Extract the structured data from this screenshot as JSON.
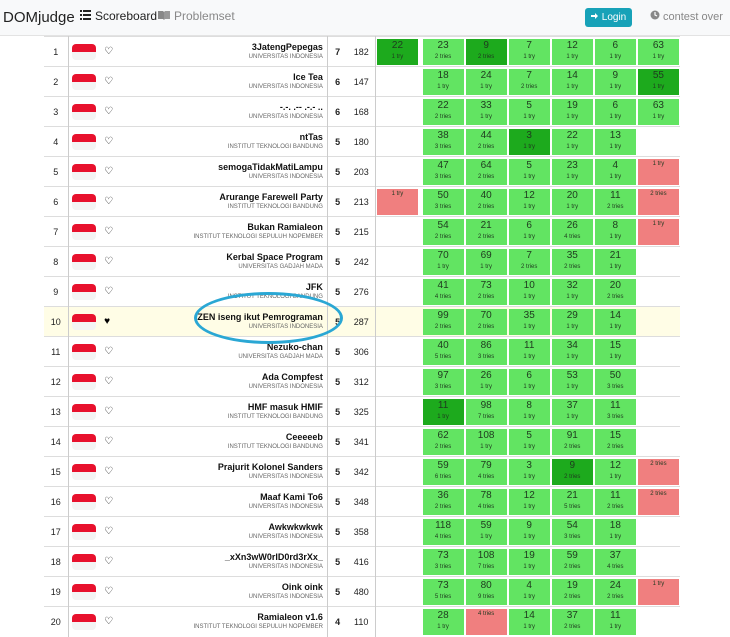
{
  "navbar": {
    "brand": "DOMjudge",
    "scoreboard_label": "Scoreboard",
    "problemset_label": "Problemset",
    "login_label": "Login",
    "status": "contest over"
  },
  "colors": {
    "solved": "#62e462",
    "first": "#1daa1d",
    "failed": "#f07f7f",
    "highlight": "#fffde6",
    "annotation": "#2aa7d4"
  },
  "rows": [
    {
      "rank": "1",
      "team": "3JatengPepegas",
      "affil": "UNIVERSITAS INDONESIA",
      "solved": "7",
      "penalty": "182",
      "fav": false,
      "highlight": false,
      "cells": [
        {
          "time": "22",
          "tries": "1 try",
          "status": "first"
        },
        {
          "time": "23",
          "tries": "2 tries",
          "status": "solved"
        },
        {
          "time": "9",
          "tries": "2 tries",
          "status": "first"
        },
        {
          "time": "7",
          "tries": "1 try",
          "status": "solved"
        },
        {
          "time": "12",
          "tries": "1 try",
          "status": "solved"
        },
        {
          "time": "6",
          "tries": "1 try",
          "status": "solved"
        },
        {
          "time": "63",
          "tries": "1 try",
          "status": "solved"
        }
      ]
    },
    {
      "rank": "2",
      "team": "Ice Tea",
      "affil": "UNIVERSITAS INDONESIA",
      "solved": "6",
      "penalty": "147",
      "fav": false,
      "highlight": false,
      "cells": [
        {
          "time": "",
          "tries": "",
          "status": "empty"
        },
        {
          "time": "18",
          "tries": "1 try",
          "status": "solved"
        },
        {
          "time": "24",
          "tries": "1 try",
          "status": "solved"
        },
        {
          "time": "7",
          "tries": "2 tries",
          "status": "solved"
        },
        {
          "time": "14",
          "tries": "1 try",
          "status": "solved"
        },
        {
          "time": "9",
          "tries": "1 try",
          "status": "solved"
        },
        {
          "time": "55",
          "tries": "1 try",
          "status": "first"
        }
      ]
    },
    {
      "rank": "3",
      "team": "-.-. .-- .-.- ..",
      "affil": "UNIVERSITAS INDONESIA",
      "solved": "6",
      "penalty": "168",
      "fav": false,
      "highlight": false,
      "cells": [
        {
          "time": "",
          "tries": "",
          "status": "empty"
        },
        {
          "time": "22",
          "tries": "2 tries",
          "status": "solved"
        },
        {
          "time": "33",
          "tries": "1 try",
          "status": "solved"
        },
        {
          "time": "5",
          "tries": "1 try",
          "status": "solved"
        },
        {
          "time": "19",
          "tries": "1 try",
          "status": "solved"
        },
        {
          "time": "6",
          "tries": "1 try",
          "status": "solved"
        },
        {
          "time": "63",
          "tries": "1 try",
          "status": "solved"
        }
      ]
    },
    {
      "rank": "4",
      "team": "ntTas",
      "affil": "INSTITUT TEKNOLOGI BANDUNG",
      "solved": "5",
      "penalty": "180",
      "fav": false,
      "highlight": false,
      "cells": [
        {
          "time": "",
          "tries": "",
          "status": "empty"
        },
        {
          "time": "38",
          "tries": "3 tries",
          "status": "solved"
        },
        {
          "time": "44",
          "tries": "2 tries",
          "status": "solved"
        },
        {
          "time": "3",
          "tries": "1 try",
          "status": "first"
        },
        {
          "time": "22",
          "tries": "1 try",
          "status": "solved"
        },
        {
          "time": "13",
          "tries": "1 try",
          "status": "solved"
        },
        {
          "time": "",
          "tries": "",
          "status": "empty"
        }
      ]
    },
    {
      "rank": "5",
      "team": "semogaTidakMatiLampu",
      "affil": "UNIVERSITAS INDONESIA",
      "solved": "5",
      "penalty": "203",
      "fav": false,
      "highlight": false,
      "cells": [
        {
          "time": "",
          "tries": "",
          "status": "empty"
        },
        {
          "time": "47",
          "tries": "3 tries",
          "status": "solved"
        },
        {
          "time": "64",
          "tries": "2 tries",
          "status": "solved"
        },
        {
          "time": "5",
          "tries": "1 try",
          "status": "solved"
        },
        {
          "time": "23",
          "tries": "1 try",
          "status": "solved"
        },
        {
          "time": "4",
          "tries": "1 try",
          "status": "solved"
        },
        {
          "time": "",
          "tries": "1 try",
          "status": "failed"
        }
      ]
    },
    {
      "rank": "6",
      "team": "Arurange Farewell Party",
      "affil": "INSTITUT TEKNOLOGI BANDUNG",
      "solved": "5",
      "penalty": "213",
      "fav": false,
      "highlight": false,
      "cells": [
        {
          "time": "",
          "tries": "1 try",
          "status": "failed"
        },
        {
          "time": "50",
          "tries": "3 tries",
          "status": "solved"
        },
        {
          "time": "40",
          "tries": "2 tries",
          "status": "solved"
        },
        {
          "time": "12",
          "tries": "1 try",
          "status": "solved"
        },
        {
          "time": "20",
          "tries": "1 try",
          "status": "solved"
        },
        {
          "time": "11",
          "tries": "2 tries",
          "status": "solved"
        },
        {
          "time": "",
          "tries": "2 tries",
          "status": "failed"
        }
      ]
    },
    {
      "rank": "7",
      "team": "Bukan Ramialeon",
      "affil": "INSTITUT TEKNOLOGI SEPULUH NOPEMBER",
      "solved": "5",
      "penalty": "215",
      "fav": false,
      "highlight": false,
      "cells": [
        {
          "time": "",
          "tries": "",
          "status": "empty"
        },
        {
          "time": "54",
          "tries": "2 tries",
          "status": "solved"
        },
        {
          "time": "21",
          "tries": "2 tries",
          "status": "solved"
        },
        {
          "time": "6",
          "tries": "1 try",
          "status": "solved"
        },
        {
          "time": "26",
          "tries": "4 tries",
          "status": "solved"
        },
        {
          "time": "8",
          "tries": "1 try",
          "status": "solved"
        },
        {
          "time": "",
          "tries": "1 try",
          "status": "failed"
        }
      ]
    },
    {
      "rank": "8",
      "team": "Kerbal Space Program",
      "affil": "UNIVERSITAS GADJAH MADA",
      "solved": "5",
      "penalty": "242",
      "fav": false,
      "highlight": false,
      "cells": [
        {
          "time": "",
          "tries": "",
          "status": "empty"
        },
        {
          "time": "70",
          "tries": "1 try",
          "status": "solved"
        },
        {
          "time": "69",
          "tries": "1 try",
          "status": "solved"
        },
        {
          "time": "7",
          "tries": "2 tries",
          "status": "solved"
        },
        {
          "time": "35",
          "tries": "2 tries",
          "status": "solved"
        },
        {
          "time": "21",
          "tries": "1 try",
          "status": "solved"
        },
        {
          "time": "",
          "tries": "",
          "status": "empty"
        }
      ]
    },
    {
      "rank": "9",
      "team": "JFK",
      "affil": "INSTITUT TEKNOLOGI BANDUNG",
      "solved": "5",
      "penalty": "276",
      "fav": false,
      "highlight": false,
      "cells": [
        {
          "time": "",
          "tries": "",
          "status": "empty"
        },
        {
          "time": "41",
          "tries": "4 tries",
          "status": "solved"
        },
        {
          "time": "73",
          "tries": "2 tries",
          "status": "solved"
        },
        {
          "time": "10",
          "tries": "1 try",
          "status": "solved"
        },
        {
          "time": "32",
          "tries": "1 try",
          "status": "solved"
        },
        {
          "time": "20",
          "tries": "2 tries",
          "status": "solved"
        },
        {
          "time": "",
          "tries": "",
          "status": "empty"
        }
      ]
    },
    {
      "rank": "10",
      "team": "ZEN iseng ikut Pemrograman",
      "affil": "UNIVERSITAS INDONESIA",
      "solved": "5",
      "penalty": "287",
      "fav": true,
      "highlight": true,
      "cells": [
        {
          "time": "",
          "tries": "",
          "status": "empty"
        },
        {
          "time": "99",
          "tries": "2 tries",
          "status": "solved"
        },
        {
          "time": "70",
          "tries": "2 tries",
          "status": "solved"
        },
        {
          "time": "35",
          "tries": "1 try",
          "status": "solved"
        },
        {
          "time": "29",
          "tries": "1 try",
          "status": "solved"
        },
        {
          "time": "14",
          "tries": "1 try",
          "status": "solved"
        },
        {
          "time": "",
          "tries": "",
          "status": "empty"
        }
      ]
    },
    {
      "rank": "11",
      "team": "Nezuko-chan",
      "affil": "UNIVERSITAS GADJAH MADA",
      "solved": "5",
      "penalty": "306",
      "fav": false,
      "highlight": false,
      "cells": [
        {
          "time": "",
          "tries": "",
          "status": "empty"
        },
        {
          "time": "40",
          "tries": "5 tries",
          "status": "solved"
        },
        {
          "time": "86",
          "tries": "3 tries",
          "status": "solved"
        },
        {
          "time": "11",
          "tries": "1 try",
          "status": "solved"
        },
        {
          "time": "34",
          "tries": "1 try",
          "status": "solved"
        },
        {
          "time": "15",
          "tries": "1 try",
          "status": "solved"
        },
        {
          "time": "",
          "tries": "",
          "status": "empty"
        }
      ]
    },
    {
      "rank": "12",
      "team": "Ada Compfest",
      "affil": "UNIVERSITAS INDONESIA",
      "solved": "5",
      "penalty": "312",
      "fav": false,
      "highlight": false,
      "cells": [
        {
          "time": "",
          "tries": "",
          "status": "empty"
        },
        {
          "time": "97",
          "tries": "3 tries",
          "status": "solved"
        },
        {
          "time": "26",
          "tries": "1 try",
          "status": "solved"
        },
        {
          "time": "6",
          "tries": "1 try",
          "status": "solved"
        },
        {
          "time": "53",
          "tries": "1 try",
          "status": "solved"
        },
        {
          "time": "50",
          "tries": "3 tries",
          "status": "solved"
        },
        {
          "time": "",
          "tries": "",
          "status": "empty"
        }
      ]
    },
    {
      "rank": "13",
      "team": "HMF masuk HMIF",
      "affil": "INSTITUT TEKNOLOGI BANDUNG",
      "solved": "5",
      "penalty": "325",
      "fav": false,
      "highlight": false,
      "cells": [
        {
          "time": "",
          "tries": "",
          "status": "empty"
        },
        {
          "time": "11",
          "tries": "1 try",
          "status": "first"
        },
        {
          "time": "98",
          "tries": "7 tries",
          "status": "solved"
        },
        {
          "time": "8",
          "tries": "1 try",
          "status": "solved"
        },
        {
          "time": "37",
          "tries": "1 try",
          "status": "solved"
        },
        {
          "time": "11",
          "tries": "3 tries",
          "status": "solved"
        },
        {
          "time": "",
          "tries": "",
          "status": "empty"
        }
      ]
    },
    {
      "rank": "14",
      "team": "Ceeeeeb",
      "affil": "INSTITUT TEKNOLOGI BANDUNG",
      "solved": "5",
      "penalty": "341",
      "fav": false,
      "highlight": false,
      "cells": [
        {
          "time": "",
          "tries": "",
          "status": "empty"
        },
        {
          "time": "62",
          "tries": "2 tries",
          "status": "solved"
        },
        {
          "time": "108",
          "tries": "1 try",
          "status": "solved"
        },
        {
          "time": "5",
          "tries": "1 try",
          "status": "solved"
        },
        {
          "time": "91",
          "tries": "2 tries",
          "status": "solved"
        },
        {
          "time": "15",
          "tries": "2 tries",
          "status": "solved"
        },
        {
          "time": "",
          "tries": "",
          "status": "empty"
        }
      ]
    },
    {
      "rank": "15",
      "team": "Prajurit Kolonel Sanders",
      "affil": "UNIVERSITAS INDONESIA",
      "solved": "5",
      "penalty": "342",
      "fav": false,
      "highlight": false,
      "cells": [
        {
          "time": "",
          "tries": "",
          "status": "empty"
        },
        {
          "time": "59",
          "tries": "6 tries",
          "status": "solved"
        },
        {
          "time": "79",
          "tries": "4 tries",
          "status": "solved"
        },
        {
          "time": "3",
          "tries": "1 try",
          "status": "solved"
        },
        {
          "time": "9",
          "tries": "2 tries",
          "status": "first"
        },
        {
          "time": "12",
          "tries": "1 try",
          "status": "solved"
        },
        {
          "time": "",
          "tries": "2 tries",
          "status": "failed"
        }
      ]
    },
    {
      "rank": "16",
      "team": "Maaf Kami To6",
      "affil": "UNIVERSITAS INDONESIA",
      "solved": "5",
      "penalty": "348",
      "fav": false,
      "highlight": false,
      "cells": [
        {
          "time": "",
          "tries": "",
          "status": "empty"
        },
        {
          "time": "36",
          "tries": "2 tries",
          "status": "solved"
        },
        {
          "time": "78",
          "tries": "4 tries",
          "status": "solved"
        },
        {
          "time": "12",
          "tries": "1 try",
          "status": "solved"
        },
        {
          "time": "21",
          "tries": "5 tries",
          "status": "solved"
        },
        {
          "time": "11",
          "tries": "2 tries",
          "status": "solved"
        },
        {
          "time": "",
          "tries": "2 tries",
          "status": "failed"
        }
      ]
    },
    {
      "rank": "17",
      "team": "Awkwkwkwk",
      "affil": "UNIVERSITAS INDONESIA",
      "solved": "5",
      "penalty": "358",
      "fav": false,
      "highlight": false,
      "cells": [
        {
          "time": "",
          "tries": "",
          "status": "empty"
        },
        {
          "time": "118",
          "tries": "4 tries",
          "status": "solved"
        },
        {
          "time": "59",
          "tries": "1 try",
          "status": "solved"
        },
        {
          "time": "9",
          "tries": "1 try",
          "status": "solved"
        },
        {
          "time": "54",
          "tries": "3 tries",
          "status": "solved"
        },
        {
          "time": "18",
          "tries": "1 try",
          "status": "solved"
        },
        {
          "time": "",
          "tries": "",
          "status": "empty"
        }
      ]
    },
    {
      "rank": "18",
      "team": "_xXn3wW0rlD0rd3rXx_",
      "affil": "UNIVERSITAS INDONESIA",
      "solved": "5",
      "penalty": "416",
      "fav": false,
      "highlight": false,
      "cells": [
        {
          "time": "",
          "tries": "",
          "status": "empty"
        },
        {
          "time": "73",
          "tries": "3 tries",
          "status": "solved"
        },
        {
          "time": "108",
          "tries": "7 tries",
          "status": "solved"
        },
        {
          "time": "19",
          "tries": "1 try",
          "status": "solved"
        },
        {
          "time": "59",
          "tries": "2 tries",
          "status": "solved"
        },
        {
          "time": "37",
          "tries": "4 tries",
          "status": "solved"
        },
        {
          "time": "",
          "tries": "",
          "status": "empty"
        }
      ]
    },
    {
      "rank": "19",
      "team": "Oink oink",
      "affil": "UNIVERSITAS INDONESIA",
      "solved": "5",
      "penalty": "480",
      "fav": false,
      "highlight": false,
      "cells": [
        {
          "time": "",
          "tries": "",
          "status": "empty"
        },
        {
          "time": "73",
          "tries": "5 tries",
          "status": "solved"
        },
        {
          "time": "80",
          "tries": "9 tries",
          "status": "solved"
        },
        {
          "time": "4",
          "tries": "1 try",
          "status": "solved"
        },
        {
          "time": "19",
          "tries": "2 tries",
          "status": "solved"
        },
        {
          "time": "24",
          "tries": "2 tries",
          "status": "solved"
        },
        {
          "time": "",
          "tries": "1 try",
          "status": "failed"
        }
      ]
    },
    {
      "rank": "20",
      "team": "Ramialeon v1.6",
      "affil": "INSTITUT TEKNOLOGI SEPULUH NOPEMBER",
      "solved": "4",
      "penalty": "110",
      "fav": false,
      "highlight": false,
      "cells": [
        {
          "time": "",
          "tries": "",
          "status": "empty"
        },
        {
          "time": "28",
          "tries": "1 try",
          "status": "solved"
        },
        {
          "time": "",
          "tries": "4 tries",
          "status": "failed"
        },
        {
          "time": "14",
          "tries": "1 try",
          "status": "solved"
        },
        {
          "time": "37",
          "tries": "2 tries",
          "status": "solved"
        },
        {
          "time": "11",
          "tries": "1 try",
          "status": "solved"
        },
        {
          "time": "",
          "tries": "",
          "status": "empty"
        }
      ]
    }
  ]
}
